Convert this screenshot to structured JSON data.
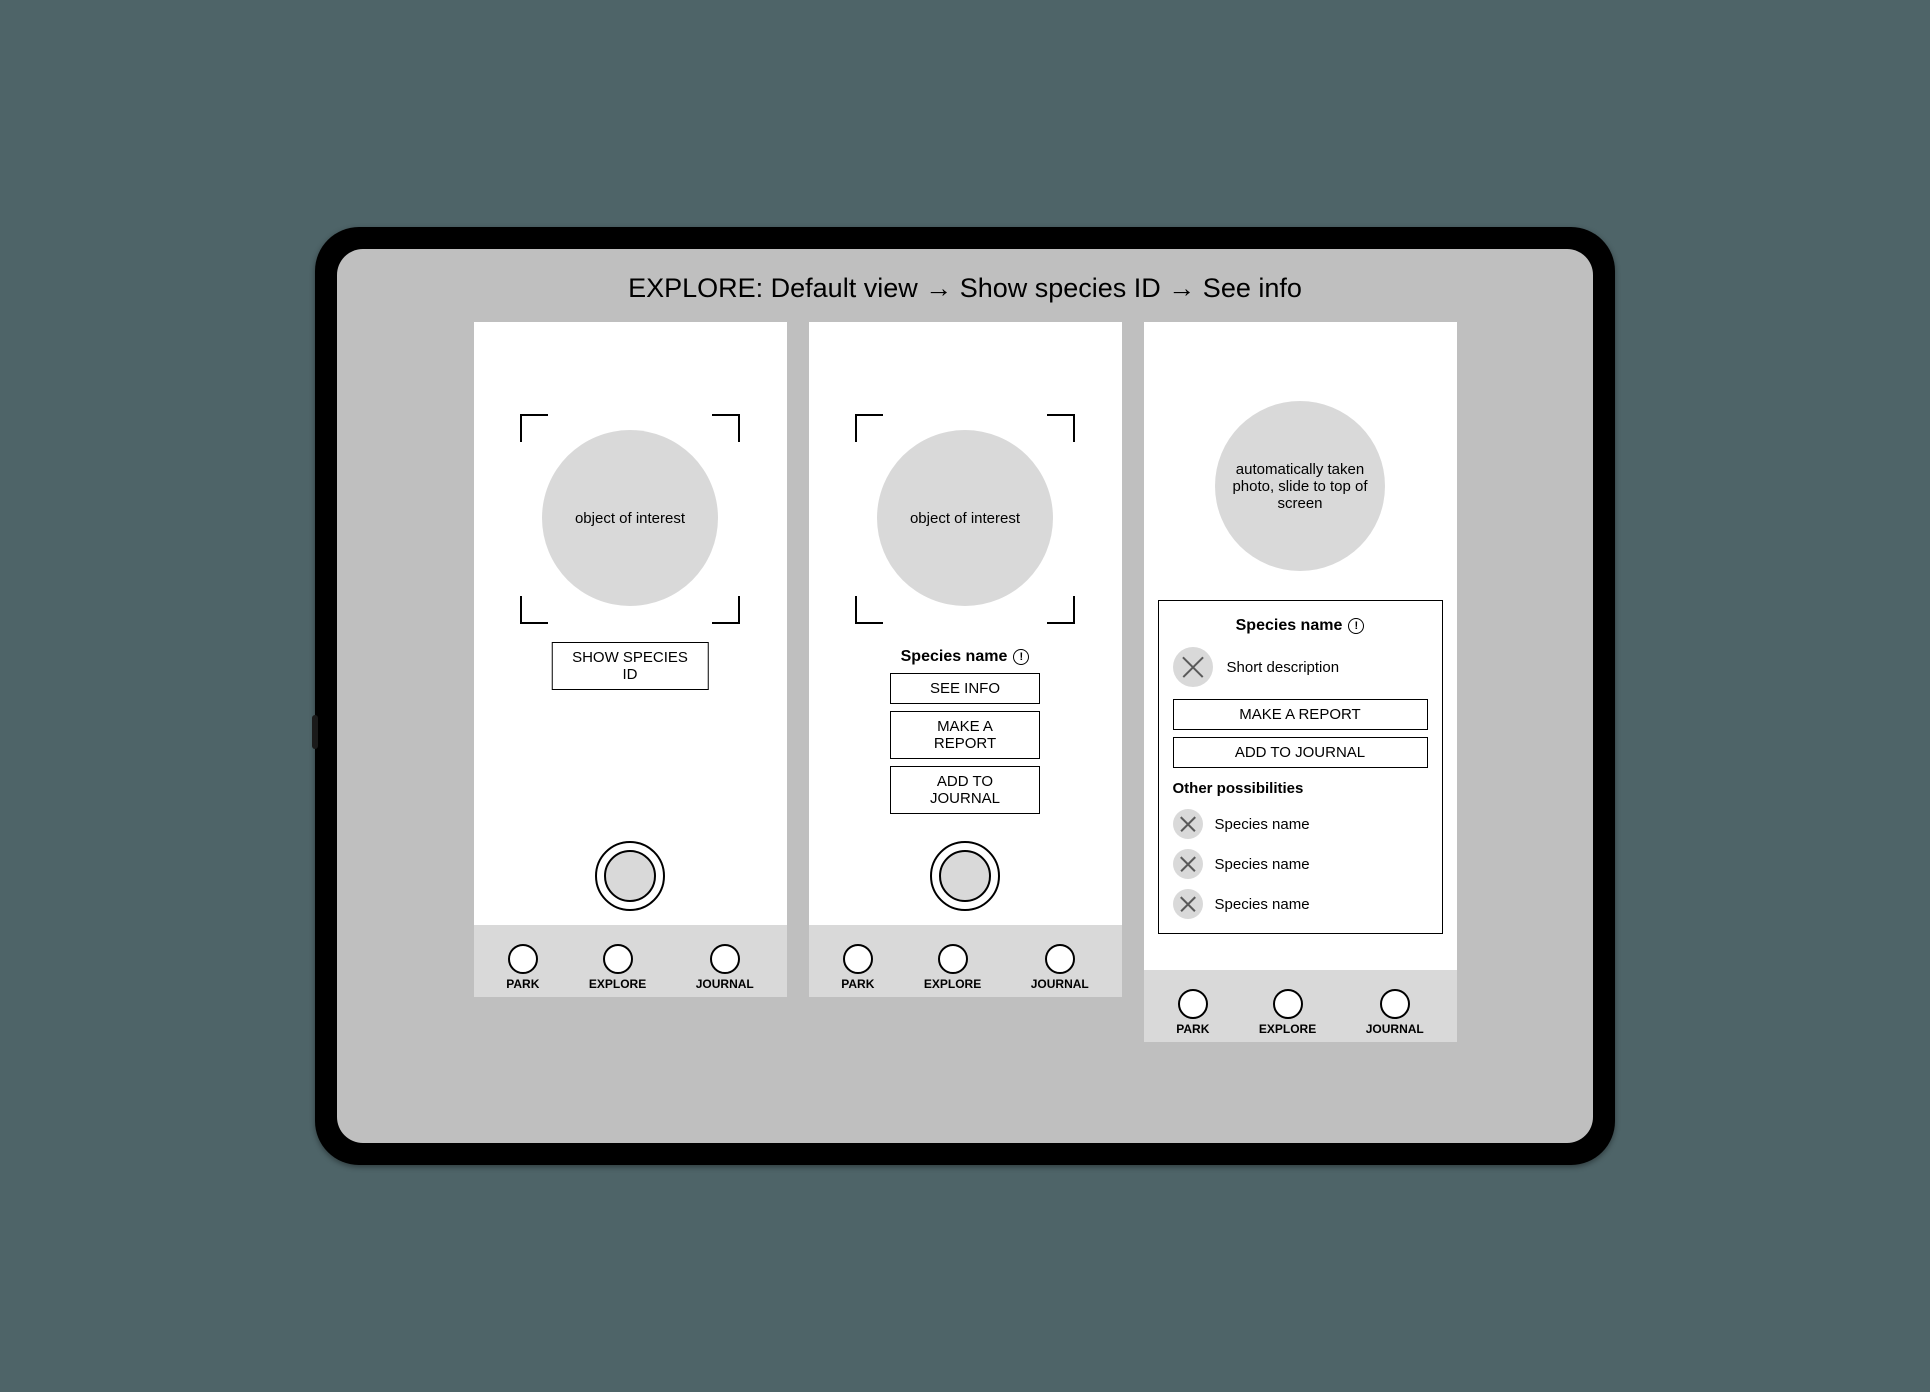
{
  "title": "EXPLORE: Default view → Show species ID → See info",
  "nav": {
    "park": "PARK",
    "explore": "EXPLORE",
    "journal": "JOURNAL"
  },
  "screenA": {
    "object_label": "object of interest",
    "show_button": "SHOW SPECIES ID"
  },
  "screenB": {
    "object_label": "object of interest",
    "species_heading": "Species name",
    "buttons": {
      "see_info": "SEE INFO",
      "report": "MAKE A REPORT",
      "journal": "ADD TO JOURNAL"
    }
  },
  "screenC": {
    "object_label": "automatically taken photo, slide to top of screen",
    "species_heading": "Species name",
    "short_desc": "Short description",
    "buttons": {
      "report": "MAKE A REPORT",
      "journal": "ADD TO JOURNAL"
    },
    "other_heading": "Other possibilities",
    "possibilities": [
      "Species name",
      "Species name",
      "Species name"
    ]
  }
}
